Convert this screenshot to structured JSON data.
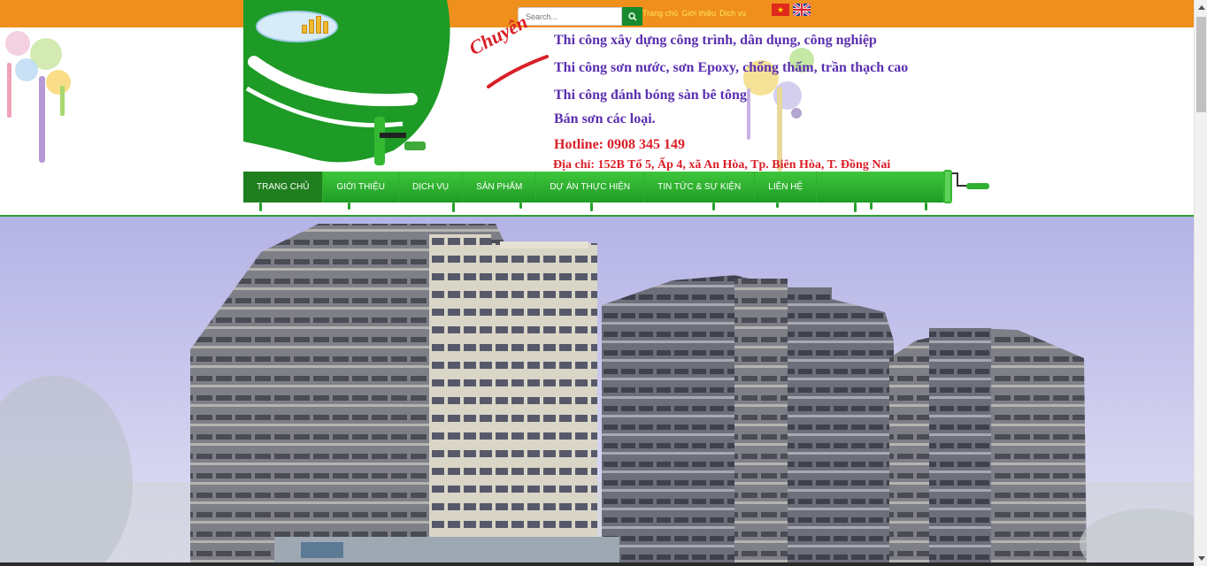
{
  "search": {
    "placeholder": "Search..."
  },
  "toplinks": [
    "Trang chủ",
    "Giới thiệu",
    "Dịch vụ"
  ],
  "flags": {
    "vn_star": "★"
  },
  "slogan": "Chuyên",
  "services": [
    "Thi công xây dựng công trình, dân dụng, công nghiệp",
    "Thi công sơn nước, sơn Epoxy, chống thấm, trần thạch cao",
    "Thi công đánh bóng sàn bê tông",
    "Bán sơn các loại."
  ],
  "hotline": "Hotline: 0908 345 149",
  "address": "Địa chỉ: 152B Tổ 5, Ấp 4, xã An Hòa, Tp. Biên Hòa, T. Đồng Nai",
  "nav": [
    "Trang chủ",
    "Giới thiệu",
    "Dịch vụ",
    "Sản phẩm",
    "Dự án thực hiện",
    "Tin tức & sự kiện",
    "Liên hệ"
  ],
  "colors": {
    "topbar": "#ef8f1c",
    "brand_green": "#1f9c25",
    "service_text": "#5a2fb0",
    "contact_text": "#d91f28"
  },
  "icons": {
    "search": "search-icon",
    "flag_vn": "vietnam-flag-icon",
    "flag_en": "uk-flag-icon"
  }
}
